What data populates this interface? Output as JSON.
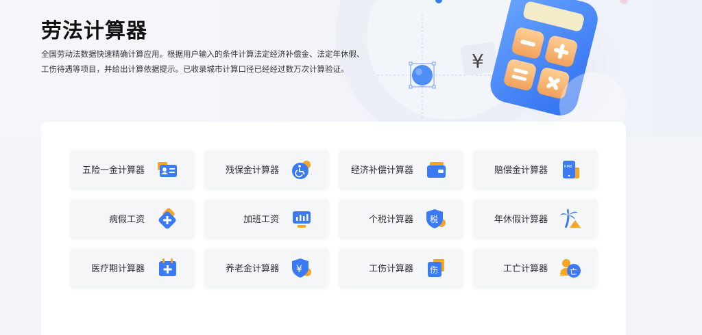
{
  "hero": {
    "title": "劳法计算器",
    "description": "全国劳动法数据快速精确计算应用。根据用户输入的条件计算法定经济补偿金、法定年休假、工伤待遇等项目，并给出计算依据提示。已收录城市计算口径已经经过数万次计算验证。",
    "illustration_symbol": "¥"
  },
  "tools": [
    {
      "label": "五险一金计算器",
      "icon": "id-card-icon"
    },
    {
      "label": "残保金计算器",
      "icon": "wheelchair-icon"
    },
    {
      "label": "经济补偿计算器",
      "icon": "wallet-icon"
    },
    {
      "label": "赔偿金计算器",
      "icon": "rmb-phone-icon"
    },
    {
      "label": "病假工资",
      "icon": "medical-cross-icon"
    },
    {
      "label": "加班工资",
      "icon": "monitor-chart-icon"
    },
    {
      "label": "个税计算器",
      "icon": "tax-shield-icon",
      "icon_text": "税"
    },
    {
      "label": "年休假计算器",
      "icon": "palm-tree-icon"
    },
    {
      "label": "医疗期计算器",
      "icon": "calendar-plus-icon"
    },
    {
      "label": "养老金计算器",
      "icon": "yuan-shield-icon",
      "icon_text": "¥"
    },
    {
      "label": "工伤计算器",
      "icon": "injury-tag-icon",
      "icon_text": "伤"
    },
    {
      "label": "工亡计算器",
      "icon": "deceased-person-icon",
      "icon_text": "亡"
    }
  ],
  "colors": {
    "accent_blue": "#3b7af5",
    "accent_orange": "#f5a623",
    "card_bg": "#ffffff",
    "tool_bg": "#f5f6f8"
  }
}
